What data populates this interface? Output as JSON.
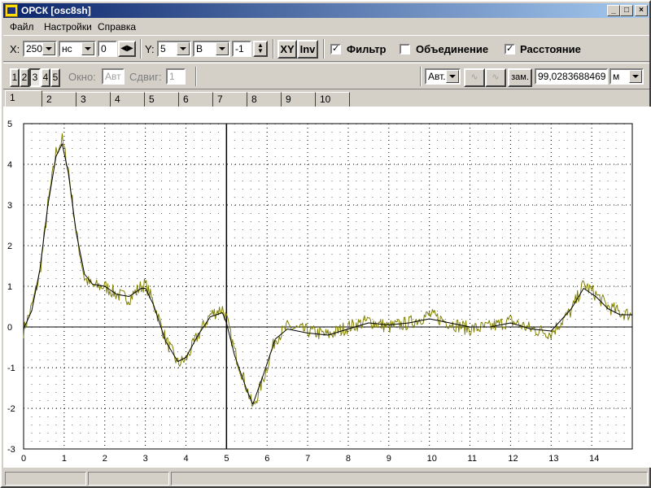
{
  "window": {
    "title": "ОРСК [osc8sh]"
  },
  "menu": [
    "Файл",
    "Настройки",
    "Справка"
  ],
  "toolbar1": {
    "x_label": "X:",
    "x_scale": "250",
    "x_unit": "нс",
    "x_offset": "0",
    "y_label": "Y:",
    "y_scale": "5",
    "y_unit": "В",
    "y_offset": "-1",
    "xy_button": "XY",
    "inv_button": "Inv",
    "filter_label": "Фильтр",
    "filter_checked": true,
    "merge_label": "Объединение",
    "merge_checked": false,
    "distance_label": "Расстояние",
    "distance_checked": true
  },
  "toolbar2": {
    "channel_buttons": [
      "1",
      "2",
      "3",
      "4",
      "5"
    ],
    "active_channel": "3",
    "window_label": "Окно:",
    "window_value": "Авт",
    "shift_label": "Сдвиг:",
    "shift_value": "1",
    "mode_select": "Авт.",
    "zam_label": "зам.",
    "distance_value": "99,02836884695",
    "distance_unit": "м"
  },
  "tabs": [
    "1",
    "2",
    "3",
    "4",
    "5",
    "6",
    "7",
    "8",
    "9",
    "10"
  ],
  "active_tab": "1",
  "chart_data": {
    "type": "line",
    "grid": true,
    "xlim": [
      0,
      15
    ],
    "ylim": [
      -3,
      5
    ],
    "xticks": [
      "0",
      "1",
      "2",
      "3",
      "4",
      "5",
      "6",
      "7",
      "8",
      "9",
      "10",
      "11",
      "12",
      "13",
      "14"
    ],
    "yticks": [
      "5",
      "4",
      "3",
      "2",
      "1",
      "0",
      "-1",
      "-2",
      "-3"
    ],
    "cursor_x": 5,
    "series": [
      {
        "color": "#808000",
        "style": "raw",
        "x": [
          0,
          0.2,
          0.4,
          0.6,
          0.8,
          0.95,
          1.1,
          1.3,
          1.5,
          1.7,
          2,
          2.3,
          2.6,
          2.9,
          3,
          3.2,
          3.5,
          3.8,
          4,
          4.3,
          4.6,
          4.9,
          5.0,
          5.2,
          5.5,
          5.65,
          5.9,
          6.2,
          6.5,
          7,
          7.5,
          8,
          8.5,
          9,
          9.5,
          10,
          10.5,
          11,
          11.5,
          12,
          12.5,
          13,
          13.5,
          13.8,
          14.1,
          14.4,
          14.7,
          15
        ],
        "y": [
          -0.1,
          0.5,
          1.3,
          3.0,
          4.3,
          4.6,
          3.9,
          2.3,
          1.2,
          1.0,
          1.0,
          0.8,
          0.7,
          1.0,
          1.05,
          0.6,
          -0.3,
          -0.9,
          -0.8,
          -0.2,
          0.3,
          0.45,
          0.2,
          -0.6,
          -1.5,
          -2.0,
          -1.3,
          -0.3,
          0.0,
          -0.1,
          -0.2,
          0.0,
          0.15,
          0.0,
          0.1,
          0.3,
          0.1,
          -0.05,
          0.0,
          0.15,
          -0.05,
          -0.15,
          0.4,
          1.05,
          0.8,
          0.5,
          0.35,
          0.3
        ]
      },
      {
        "color": "#000000",
        "style": "smooth",
        "x": [
          0,
          0.2,
          0.4,
          0.6,
          0.8,
          0.95,
          1.1,
          1.3,
          1.5,
          1.7,
          2,
          2.3,
          2.6,
          2.9,
          3,
          3.2,
          3.5,
          3.8,
          4,
          4.3,
          4.6,
          4.9,
          5.0,
          5.2,
          5.5,
          5.65,
          5.9,
          6.2,
          6.5,
          7,
          7.5,
          8,
          8.5,
          9,
          9.5,
          10,
          10.5,
          11,
          11.5,
          12,
          12.5,
          13,
          13.5,
          13.8,
          14.1,
          14.4,
          14.7,
          15
        ],
        "y": [
          -0.05,
          0.4,
          1.4,
          3.0,
          4.2,
          4.5,
          3.8,
          2.3,
          1.3,
          1.05,
          1.0,
          0.8,
          0.75,
          0.95,
          0.95,
          0.55,
          -0.35,
          -0.85,
          -0.75,
          -0.2,
          0.25,
          0.35,
          0.1,
          -0.7,
          -1.55,
          -1.9,
          -1.2,
          -0.3,
          -0.05,
          -0.15,
          -0.2,
          -0.05,
          0.1,
          0.05,
          0.1,
          0.2,
          0.1,
          0.0,
          0.0,
          0.1,
          -0.05,
          -0.1,
          0.45,
          0.95,
          0.75,
          0.45,
          0.3,
          0.3
        ]
      }
    ]
  }
}
